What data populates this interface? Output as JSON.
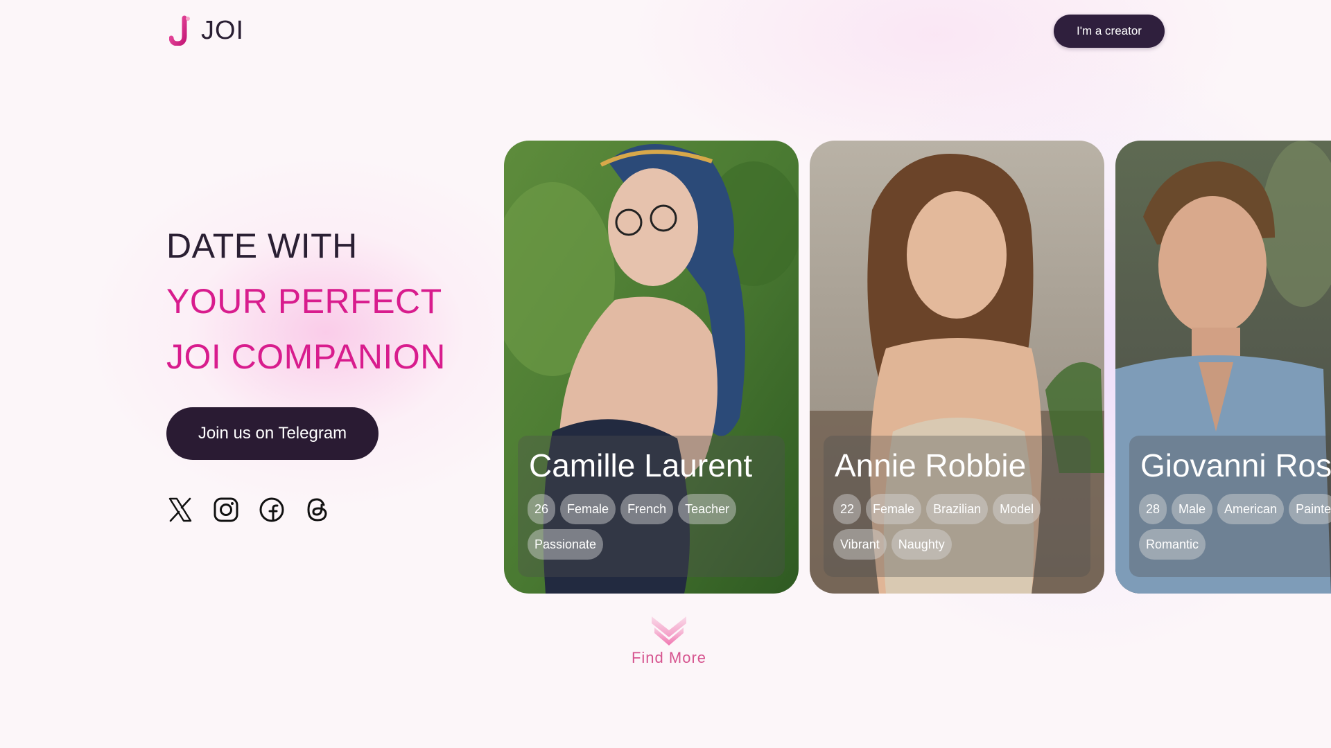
{
  "header": {
    "logo_text": "JOI",
    "creator_button": "I'm a creator"
  },
  "hero": {
    "line1": "DATE WITH",
    "line2": "YOUR PERFECT",
    "line3": "JOI COMPANION",
    "telegram_button": "Join us on Telegram",
    "socials": [
      "x-icon",
      "instagram-icon",
      "facebook-icon",
      "threads-icon"
    ]
  },
  "cards": [
    {
      "name": "Camille Laurent",
      "tags": [
        "26",
        "Female",
        "French",
        "Teacher",
        "Passionate"
      ]
    },
    {
      "name": "Annie Robbie",
      "tags": [
        "22",
        "Female",
        "Brazilian",
        "Model",
        "Vibrant",
        "Naughty"
      ]
    },
    {
      "name": "Giovanni Ross",
      "tags": [
        "28",
        "Male",
        "American",
        "Painte",
        "Romantic"
      ]
    }
  ],
  "find_more": "Find More",
  "colors": {
    "accent_pink": "#d81c8d",
    "dark": "#2a1b33",
    "background": "#fcf6f9"
  }
}
